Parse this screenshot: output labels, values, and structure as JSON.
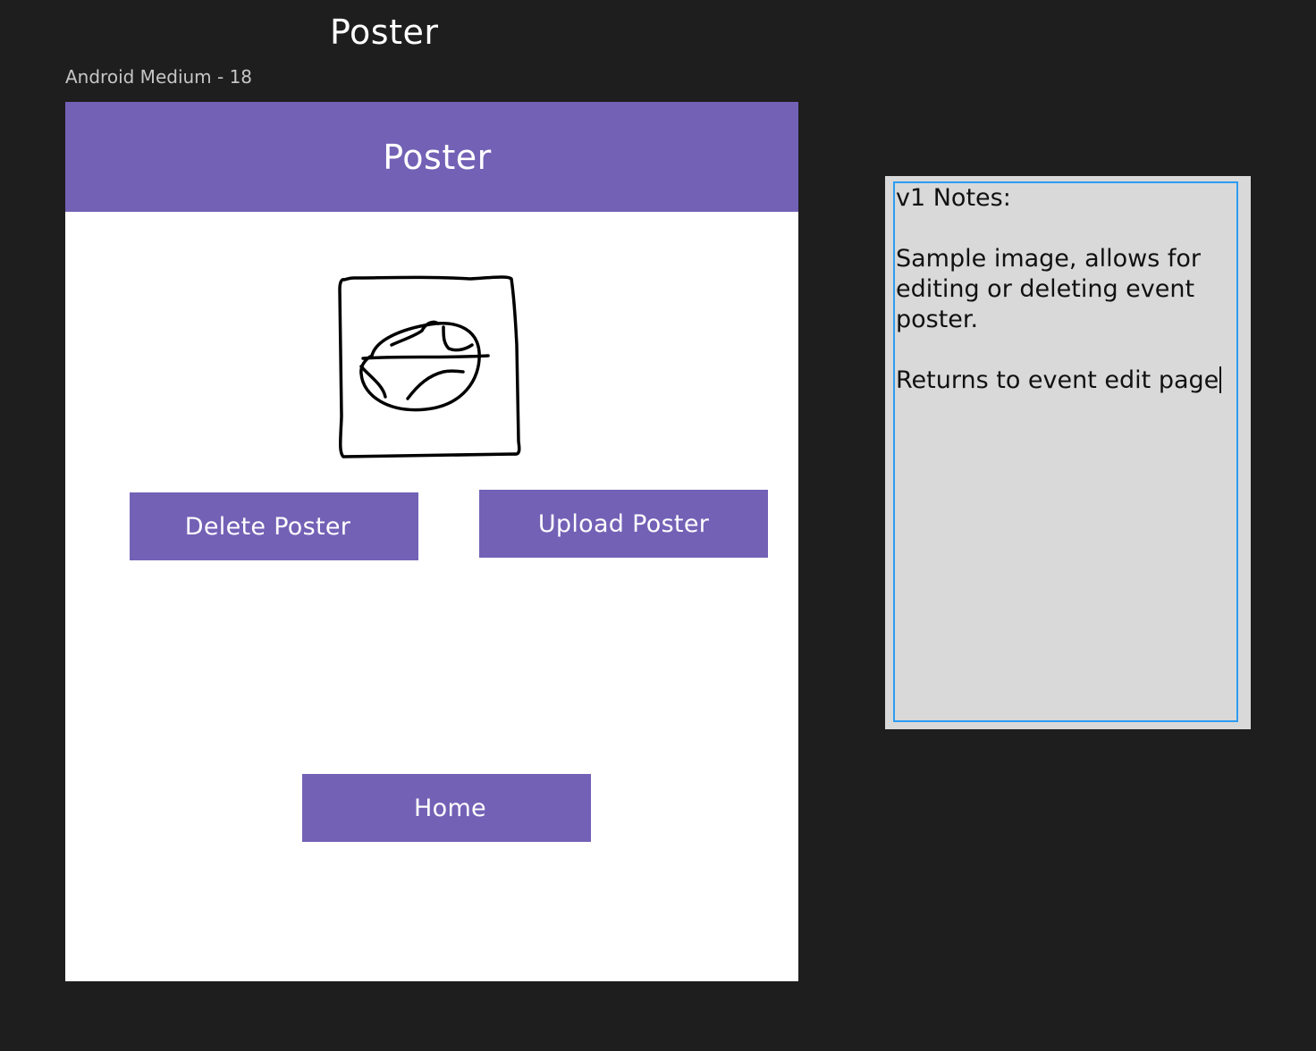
{
  "canvas": {
    "title": "Poster",
    "frame_label": "Android Medium - 18"
  },
  "app": {
    "title": "Poster",
    "image_icon": "hand-drawn-image-icon",
    "buttons": {
      "delete": "Delete Poster",
      "upload": "Upload Poster",
      "home": "Home"
    }
  },
  "notes": {
    "heading": "v1 Notes:",
    "body": "Sample image, allows for editing or deleting event poster.",
    "footer": "Returns to event edit page"
  },
  "colors": {
    "canvas_background": "#1e1e1e",
    "primary": "#7361b6",
    "note_background": "#d9d9d9",
    "selection_border": "#2d9cf3"
  }
}
